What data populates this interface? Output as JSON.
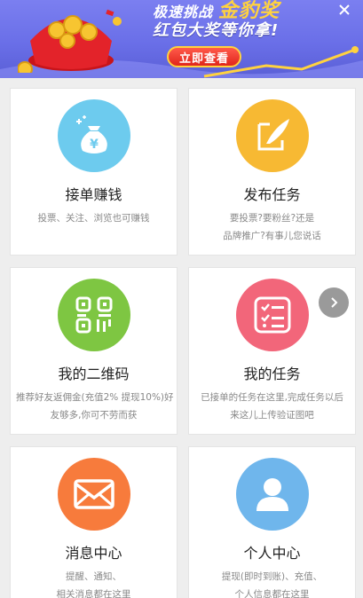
{
  "banner": {
    "line1_prefix": "极速挑战",
    "line1_gold": "金豹奖",
    "line2": "红包大奖等你拿!",
    "button_label": "立即查看"
  },
  "cards": [
    {
      "title": "接单赚钱",
      "desc": [
        "投票、关注、浏览也可赚钱"
      ],
      "color": "#6dcbee",
      "icon": "money-bag-icon"
    },
    {
      "title": "发布任务",
      "desc": [
        "要投票?要粉丝?还是",
        "品牌推广?有事儿您说话"
      ],
      "color": "#f7b933",
      "icon": "feather-edit-icon"
    },
    {
      "title": "我的二维码",
      "desc": [
        "推荐好友返佣金(充值2% 提现10%)好",
        "友够多,你可不劳而获"
      ],
      "color": "#7ec642",
      "icon": "qr-code-icon"
    },
    {
      "title": "我的任务",
      "desc": [
        "已接单的任务在这里,完成任务以后",
        "来这儿上传验证图吧"
      ],
      "color": "#f2667a",
      "icon": "checklist-icon"
    },
    {
      "title": "消息中心",
      "desc": [
        "提醒、通知、",
        "相关消息都在这里"
      ],
      "color": "#f77b3c",
      "icon": "envelope-icon"
    },
    {
      "title": "个人中心",
      "desc": [
        "提现(即时到账)、充值、",
        "个人信息都在这里"
      ],
      "color": "#6fb6ec",
      "icon": "user-icon"
    }
  ]
}
